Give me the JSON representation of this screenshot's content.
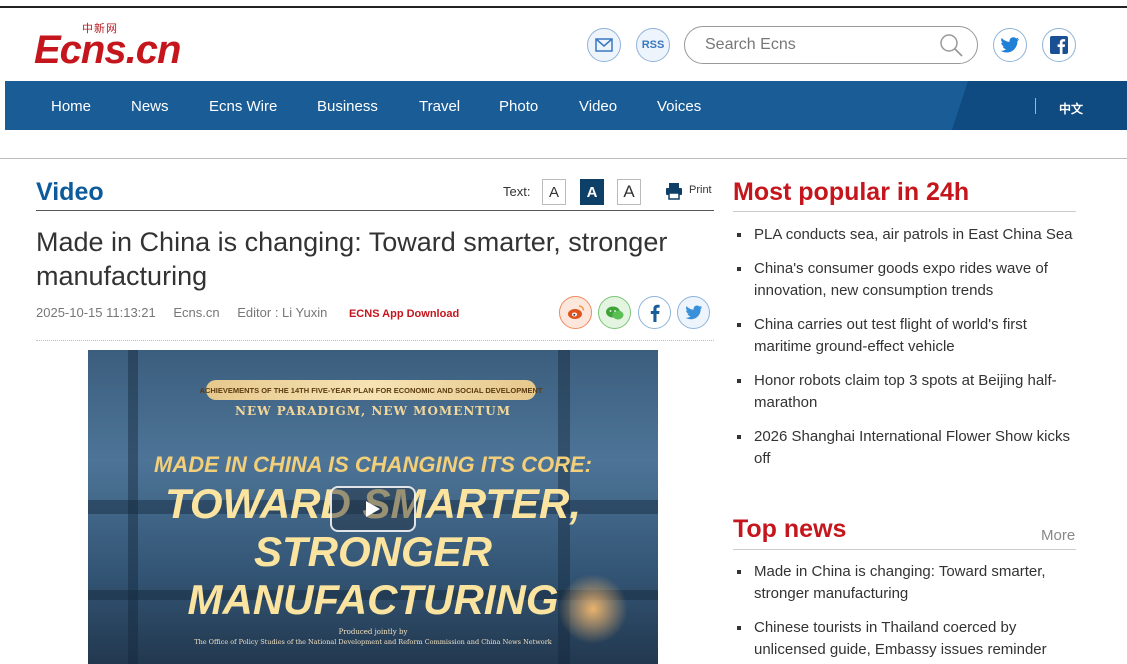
{
  "header": {
    "logo_cn": "中新网",
    "logo_text": "Ecns.cn",
    "rss_label": "RSS",
    "search_placeholder": "Search Ecns"
  },
  "nav": {
    "items": [
      "Home",
      "News",
      "Ecns Wire",
      "Business",
      "Travel",
      "Photo",
      "Video",
      "Voices"
    ],
    "lang_switch": "中文"
  },
  "article": {
    "section": "Video",
    "text_label": "Text:",
    "size_buttons": [
      "A",
      "A",
      "A"
    ],
    "print_label": "Print",
    "headline": "Made in China is changing: Toward smarter, stronger manufacturing",
    "date": "2025-10-15 11:13:21",
    "source": "Ecns.cn",
    "editor": "Editor : Li Yuxin",
    "app_download": "ECNS App Download"
  },
  "video": {
    "banner": "ACHIEVEMENTS OF THE 14TH FIVE-YEAR PLAN FOR ECONOMIC AND SOCIAL DEVELOPMENT",
    "subtitle": "NEW PARADIGM, NEW MOMENTUM",
    "line1": "MADE IN CHINA IS CHANGING ITS CORE:",
    "line2": "TOWARD SMARTER,",
    "line3": "STRONGER MANUFACTURING",
    "credit1": "Produced jointly by",
    "credit2": "The Office of Policy Studies of the National Development and Reform Commission and China News Network"
  },
  "most_popular": {
    "title": "Most popular in 24h",
    "items": [
      "PLA conducts sea, air patrols in East China Sea",
      "China's consumer goods expo rides wave of innovation, new consumption trends",
      "China carries out test flight of world's first maritime ground-effect vehicle",
      "Honor robots claim top 3 spots at Beijing half-marathon",
      "2026 Shanghai International Flower Show kicks off"
    ]
  },
  "top_news": {
    "title": "Top news",
    "more_label": "More",
    "items": [
      "Made in China is changing: Toward smarter, stronger manufacturing",
      "Chinese tourists in Thailand coerced by unlicensed guide, Embassy issues reminder"
    ]
  },
  "colors": {
    "brand_red": "#c4161c",
    "nav_blue": "#1a5c96",
    "section_blue": "#0d5b9a"
  }
}
